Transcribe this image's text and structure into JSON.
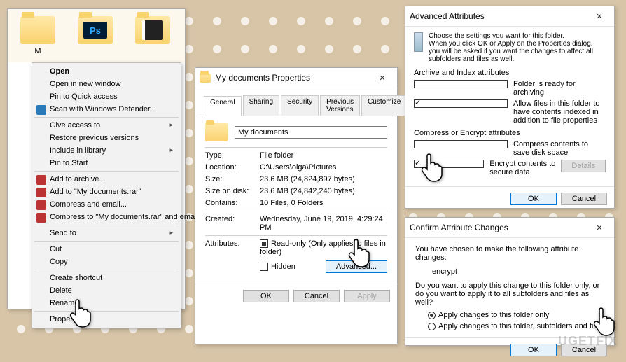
{
  "desktop": {
    "folders": [
      {
        "label": "M"
      },
      {
        "label": ""
      },
      {
        "label": ""
      }
    ]
  },
  "context_menu": {
    "items": [
      {
        "label": "Open",
        "bold": true
      },
      {
        "label": "Open in new window"
      },
      {
        "label": "Pin to Quick access"
      },
      {
        "label": "Scan with Windows Defender...",
        "icon": "bl"
      },
      {
        "label": "Give access to",
        "arrow": true
      },
      {
        "label": "Restore previous versions"
      },
      {
        "label": "Include in library",
        "arrow": true
      },
      {
        "label": "Pin to Start"
      },
      {
        "label": "Add to archive...",
        "icon": "red"
      },
      {
        "label": "Add to \"My documents.rar\"",
        "icon": "red"
      },
      {
        "label": "Compress and email...",
        "icon": "red"
      },
      {
        "label": "Compress to \"My documents.rar\" and email",
        "icon": "red"
      },
      {
        "label": "Send to",
        "arrow": true
      },
      {
        "label": "Cut"
      },
      {
        "label": "Copy"
      },
      {
        "label": "Create shortcut"
      },
      {
        "label": "Delete"
      },
      {
        "label": "Rename"
      },
      {
        "label": "Properties"
      }
    ],
    "separators_after": [
      3,
      7,
      11,
      12,
      14,
      17
    ]
  },
  "properties": {
    "title": "My documents Properties",
    "tabs": [
      "General",
      "Sharing",
      "Security",
      "Previous Versions",
      "Customize"
    ],
    "name": "My documents",
    "rows": {
      "type_k": "Type:",
      "type_v": "File folder",
      "loc_k": "Location:",
      "loc_v": "C:\\Users\\olga\\Pictures",
      "size_k": "Size:",
      "size_v": "23.6 MB (24,824,897 bytes)",
      "disk_k": "Size on disk:",
      "disk_v": "23.6 MB (24,842,240 bytes)",
      "cont_k": "Contains:",
      "cont_v": "10 Files, 0 Folders",
      "created_k": "Created:",
      "created_v": "Wednesday, June 19, 2019, 4:29:24 PM",
      "attr_k": "Attributes:",
      "readonly": "Read-only (Only applies to files in folder)",
      "hidden": "Hidden",
      "advanced_btn": "Advanced..."
    },
    "buttons": {
      "ok": "OK",
      "cancel": "Cancel",
      "apply": "Apply"
    }
  },
  "advanced": {
    "title": "Advanced Attributes",
    "intro": "Choose the settings you want for this folder.\nWhen you click OK or Apply on the Properties dialog, you will be asked if you want the changes to affect all subfolders and files as well.",
    "sect1": "Archive and Index attributes",
    "cb1": "Folder is ready for archiving",
    "cb2": "Allow files in this folder to have contents indexed in addition to file properties",
    "sect2": "Compress or Encrypt attributes",
    "cb3": "Compress contents to save disk space",
    "cb4": "Encrypt contents to secure data",
    "details_btn": "Details",
    "ok": "OK",
    "cancel": "Cancel"
  },
  "confirm": {
    "title": "Confirm Attribute Changes",
    "line1": "You have chosen to make the following attribute changes:",
    "change": "encrypt",
    "line2": "Do you want to apply this change to this folder only, or do you want to apply it to all subfolders and files as well?",
    "opt1": "Apply changes to this folder only",
    "opt2": "Apply changes to this folder, subfolders and files",
    "ok": "OK",
    "cancel": "Cancel"
  },
  "watermark": "UGETFIX"
}
